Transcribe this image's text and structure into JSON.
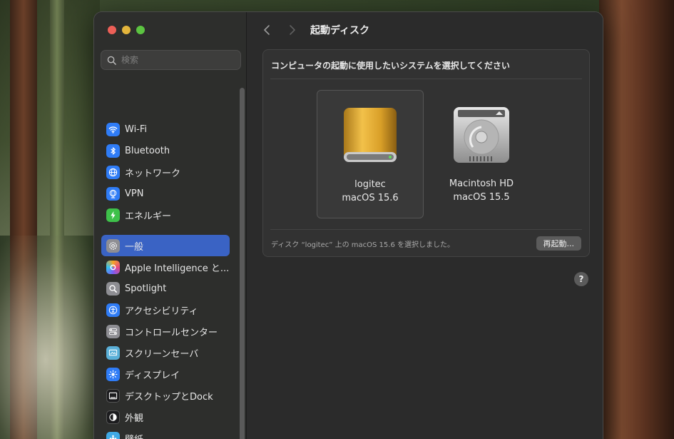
{
  "sidebar": {
    "search_placeholder": "検索",
    "items_top": [
      {
        "label": "Wi-Fi",
        "icon": "wifi-icon",
        "color": "#2f7cf6"
      },
      {
        "label": "Bluetooth",
        "icon": "bluetooth-icon",
        "color": "#2f7cf6"
      },
      {
        "label": "ネットワーク",
        "icon": "globe-icon",
        "color": "#2f7cf6"
      },
      {
        "label": "VPN",
        "icon": "vpn-globe-icon",
        "color": "#2f7cf6"
      },
      {
        "label": "エネルギー",
        "icon": "battery-bolt-icon",
        "color": "#3ec14a"
      }
    ],
    "items_main": [
      {
        "label": "一般",
        "icon": "gear-icon",
        "color": "#8e8e93"
      },
      {
        "label": "Apple Intelligence と...",
        "icon": "apple-intelligence-icon",
        "color": "#e58f4a"
      },
      {
        "label": "Spotlight",
        "icon": "magnifier-icon",
        "color": "#8e8e93"
      },
      {
        "label": "アクセシビリティ",
        "icon": "accessibility-icon",
        "color": "#2f7cf6"
      },
      {
        "label": "コントロールセンター",
        "icon": "toggles-icon",
        "color": "#8e8e93"
      },
      {
        "label": "スクリーンセーバ",
        "icon": "screensaver-icon",
        "color": "#5ab0d8"
      },
      {
        "label": "ディスプレイ",
        "icon": "sun-icon",
        "color": "#2f7cf6"
      },
      {
        "label": "デスクトップとDock",
        "icon": "dock-icon",
        "color": "#1c1c1e"
      },
      {
        "label": "外観",
        "icon": "appearance-icon",
        "color": "#1c1c1e"
      },
      {
        "label": "壁紙",
        "icon": "wallpaper-icon",
        "color": "#3fa9e5"
      }
    ]
  },
  "main": {
    "title": "起動ディスク",
    "prompt": "コンピュータの起動に使用したいシステムを選択してください",
    "disks": [
      {
        "name": "logitec",
        "version": "macOS 15.6",
        "icon": "external-drive-icon",
        "selected": true
      },
      {
        "name": "Macintosh HD",
        "version": "macOS 15.5",
        "icon": "internal-drive-icon",
        "selected": false
      }
    ],
    "status": "ディスク “logitec” 上の macOS 15.6 を選択しました。",
    "restart_label": "再起動...",
    "help_label": "?"
  }
}
